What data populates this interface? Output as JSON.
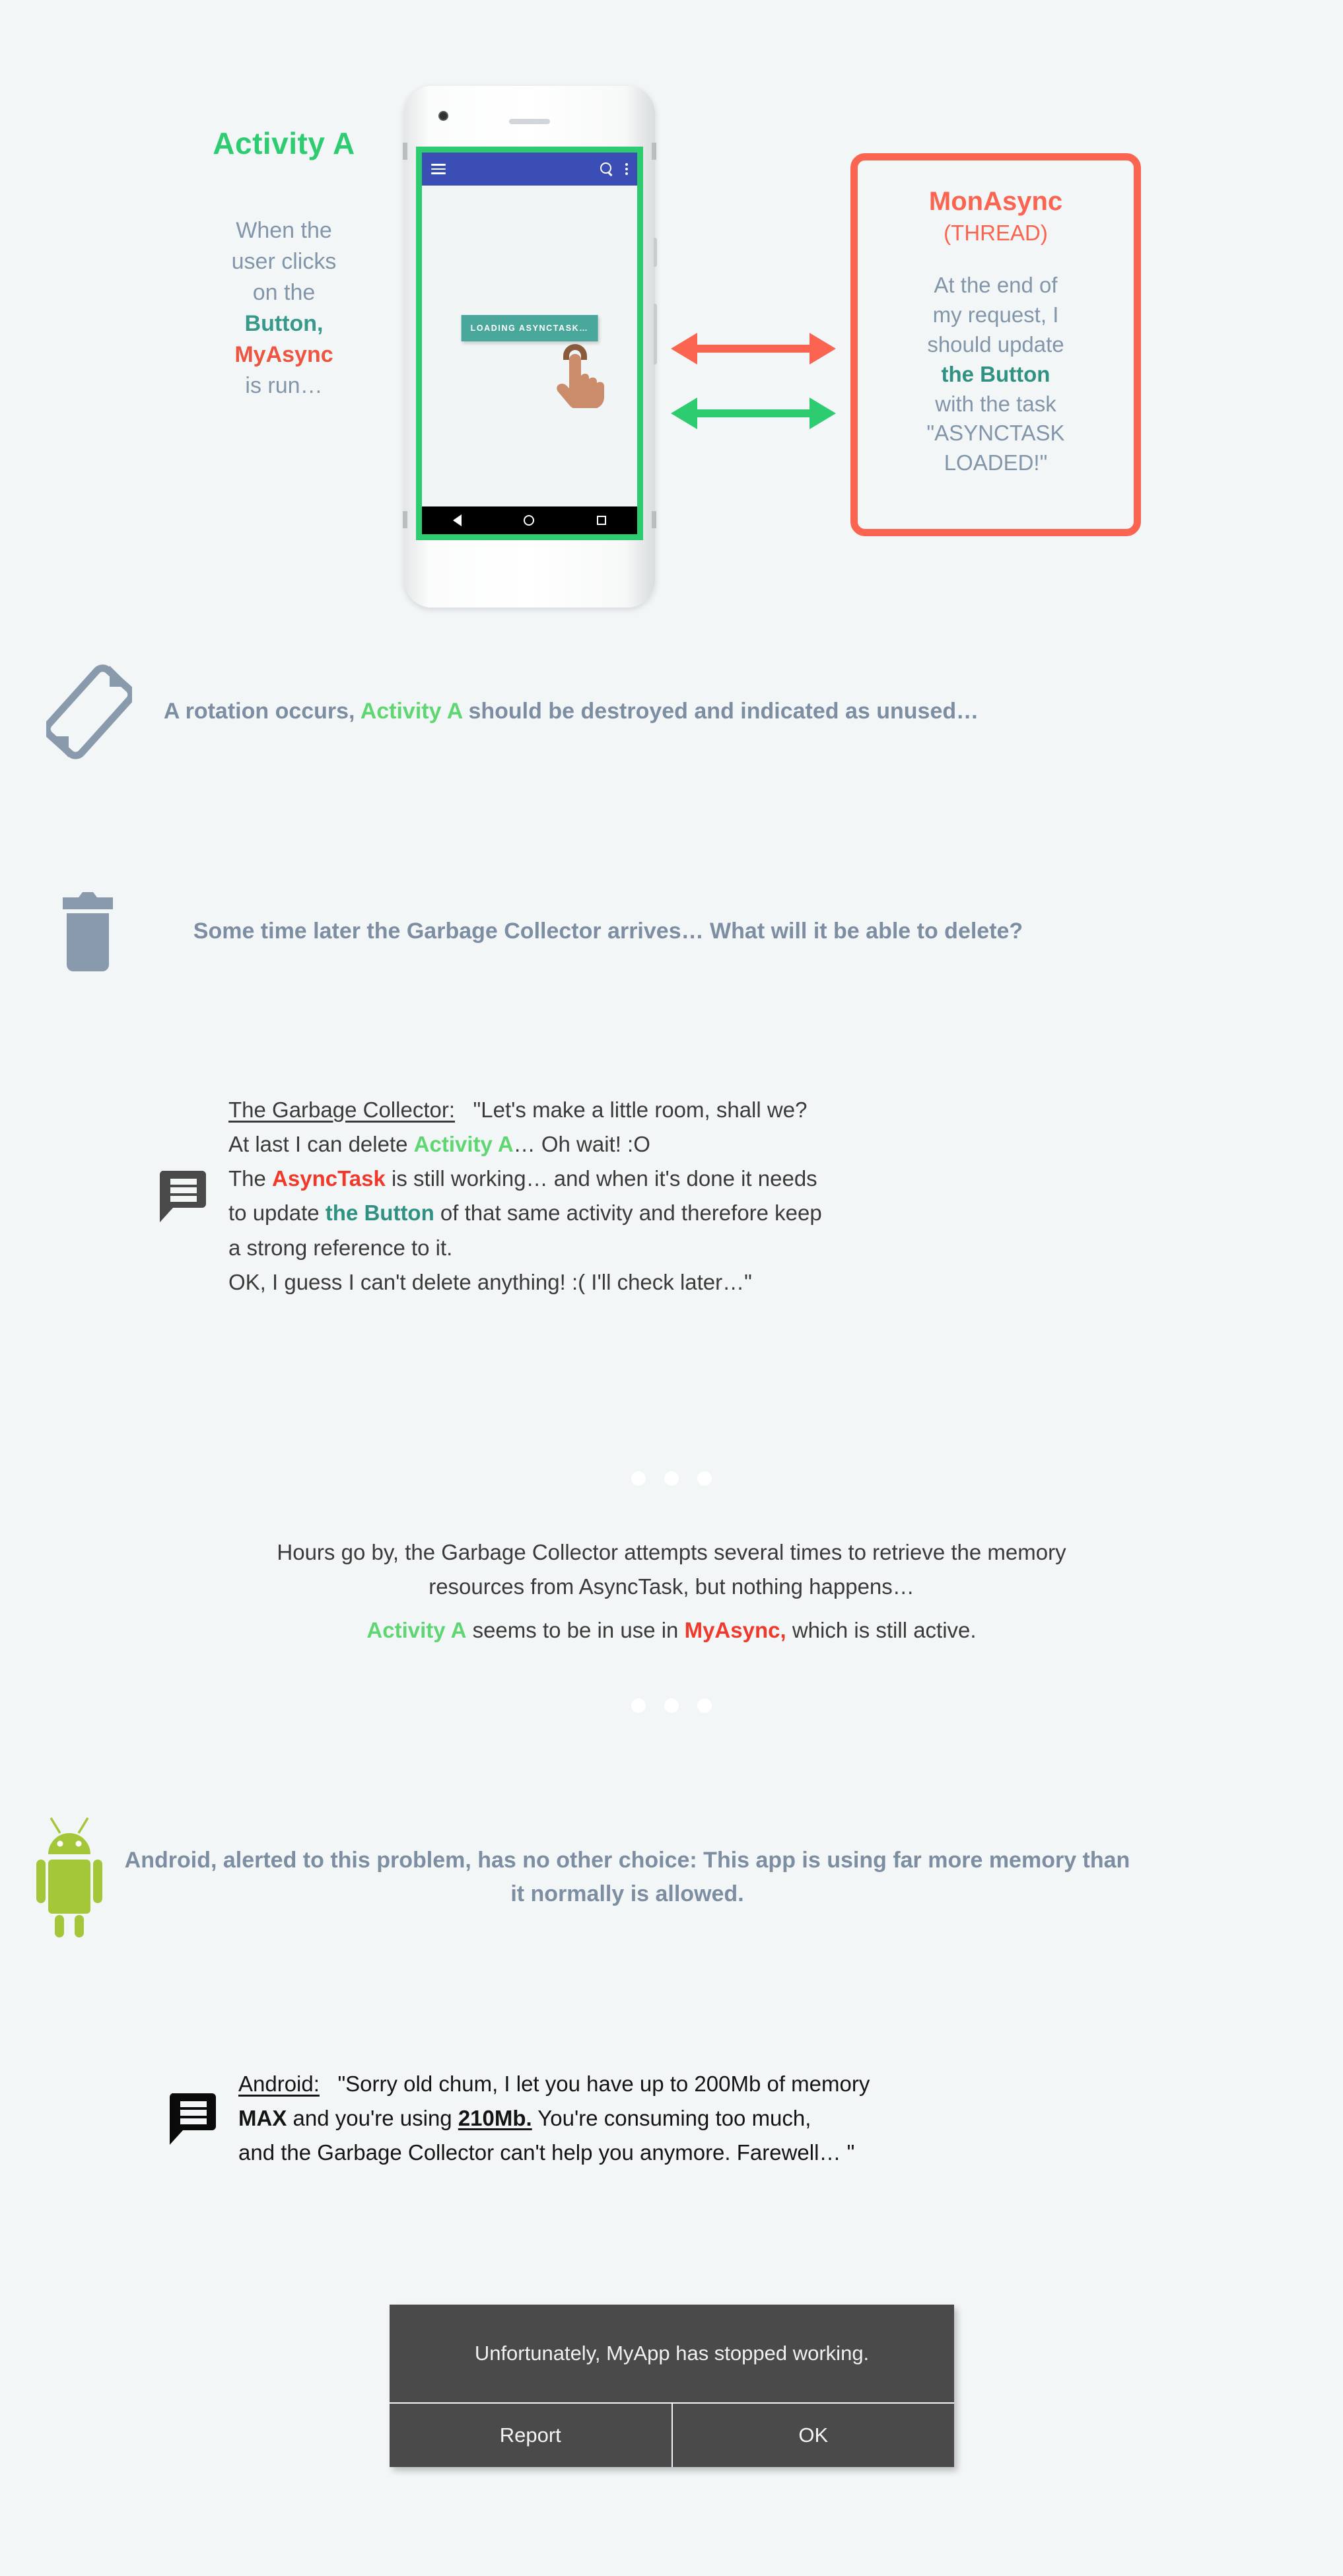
{
  "diagram": {
    "activity_title": "Activity A",
    "left_text": {
      "line1": "When the",
      "line2": "user clicks",
      "line3": "on the",
      "button": "Button,",
      "async": "MyAsync",
      "line4": "is run…"
    },
    "phone": {
      "app_button_label": "LOADING ASYNCTASK…",
      "menu_icon": "hamburger-icon",
      "search_icon": "search-icon",
      "overflow_icon": "more-vertical-icon",
      "nav_back": "back-triangle-icon",
      "nav_home": "home-circle-icon",
      "nav_recents": "recents-square-icon"
    },
    "arrows": {
      "top_color": "#fa6450",
      "bottom_color": "#2ecc71"
    },
    "mon_card": {
      "title": "MonAsync",
      "subtitle": "(THREAD)",
      "line1": "At the end of",
      "line2": "my request, I",
      "line3": "should update",
      "button": "the Button",
      "line4": "with the task",
      "line5": "\"ASYNCTASK",
      "line6": "LOADED!\""
    }
  },
  "rotation": {
    "icon": "screen-rotation-icon",
    "text_pre": "A rotation occurs, ",
    "highlight": "Activity A",
    "text_post": " should be destroyed and indicated as unused…"
  },
  "garbage": {
    "icon": "trash-icon",
    "text": "Some time later the Garbage Collector arrives… What will it be able to delete?"
  },
  "gc_speech": {
    "icon": "speech-bubble-icon",
    "speaker": "The Garbage Collector:",
    "l1_quote": "\"Let's make a little room, shall we?",
    "l2_a": "At last I can delete ",
    "l2_green": "Activity A",
    "l2_b": "… Oh wait! :O",
    "l3_a": "The ",
    "l3_red": "AsyncTask",
    "l3_b": " is still working… and when it's done it needs",
    "l4_a": "to update ",
    "l4_teal": "the Button",
    "l4_b": " of that same activity and therefore keep",
    "l5": "a strong reference to it.",
    "l6": "OK, I guess I can't delete anything! :( I'll check later…\""
  },
  "hours": {
    "l1": "Hours go by, the Garbage Collector attempts several times to retrieve the memory",
    "l2": "resources from AsyncTask, but nothing happens…",
    "l3_green": "Activity A",
    "l3_mid": " seems to be in use in ",
    "l3_red": "MyAsync,",
    "l3_end": " which is still active."
  },
  "android": {
    "icon": "android-robot-icon",
    "text": "Android, alerted to this problem, has no other choice: This app is using far more memory than it normally is allowed."
  },
  "android_speech": {
    "icon": "speech-bubble-icon",
    "speaker": "Android:",
    "l1": "\"Sorry old chum, I let you have up to 200Mb of memory",
    "l2_max": "MAX",
    "l2_a": " and you're using ",
    "l2_amount": "210Mb.",
    "l2_b": " You're consuming too much,",
    "l3": "and the Garbage Collector can't help you anymore. Farewell… \""
  },
  "crash_dialog": {
    "message": "Unfortunately, MyApp has stopped working.",
    "report_label": "Report",
    "ok_label": "OK"
  }
}
